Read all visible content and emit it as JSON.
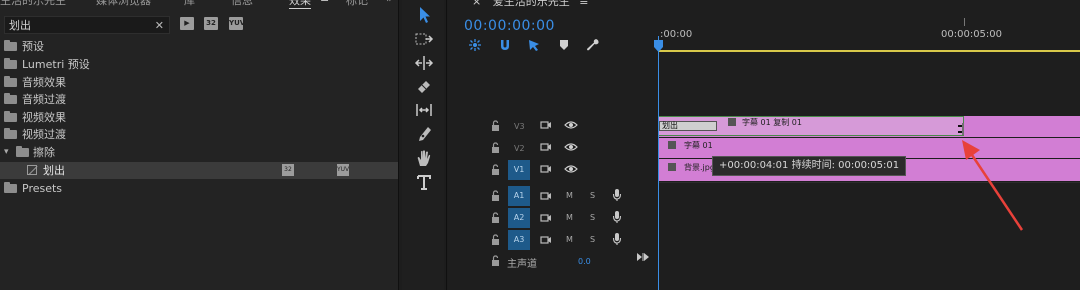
{
  "effects_panel": {
    "tabs": [
      {
        "label": "生活的乐先生",
        "active": false
      },
      {
        "label": "媒体浏览器",
        "active": false
      },
      {
        "label": "库",
        "active": false
      },
      {
        "label": "信息",
        "active": false
      },
      {
        "label": "效果",
        "active": true
      },
      {
        "label": "标记",
        "active": false
      }
    ],
    "tab_menu": "≡",
    "overflow": "»",
    "search": {
      "value": "划出",
      "clear": "✕"
    },
    "filter_icons": [
      "accelerated-effects-icon",
      "32bit-effects-icon",
      "yuv-effects-icon"
    ],
    "filter_icon_text": [
      "▶",
      "32",
      "YUV"
    ],
    "tree": [
      {
        "label": "预设",
        "type": "folder-special"
      },
      {
        "label": "Lumetri 预设",
        "type": "folder-special"
      },
      {
        "label": "音频效果",
        "type": "folder"
      },
      {
        "label": "音频过渡",
        "type": "folder"
      },
      {
        "label": "视频效果",
        "type": "folder"
      },
      {
        "label": "视频过渡",
        "type": "folder"
      },
      {
        "label": "擦除",
        "type": "folder-open"
      },
      {
        "label": "划出",
        "type": "effect",
        "selected": true
      },
      {
        "label": "Presets",
        "type": "folder-special"
      }
    ]
  },
  "tools": [
    "selection-tool",
    "track-select-tool",
    "ripple-edit-tool",
    "razor-tool",
    "slip-tool",
    "pen-tool",
    "hand-tool",
    "type-tool"
  ],
  "timeline": {
    "sequence_title": "爱生活的乐先生",
    "menu": "≡",
    "close": "×",
    "timecode": "00:00:00:00",
    "ruler_labels": [
      ":00:00",
      "00:00:05:00"
    ],
    "video_tracks": [
      {
        "name": "V3",
        "active": false
      },
      {
        "name": "V2",
        "active": false
      },
      {
        "name": "V1",
        "active": true
      }
    ],
    "audio_tracks": [
      {
        "name": "A1",
        "m": "M",
        "s": "S"
      },
      {
        "name": "A2",
        "m": "M",
        "s": "S"
      },
      {
        "name": "A3",
        "m": "M",
        "s": "S"
      }
    ],
    "master": {
      "label": "主声道",
      "value": "0.0"
    },
    "clips": {
      "v3_transition": "划出",
      "v3_clip": "字幕 01 复制 01",
      "v2_clip": "字幕 01",
      "v1_clip": "背景.jpg"
    },
    "tooltip": "+00:00:04:01 持续时间: 00:00:05:01"
  },
  "colors": {
    "accent": "#3a8ee6",
    "clip": "#d27ed4",
    "workbar": "#d8c94a",
    "arrow": "#e8413a"
  }
}
